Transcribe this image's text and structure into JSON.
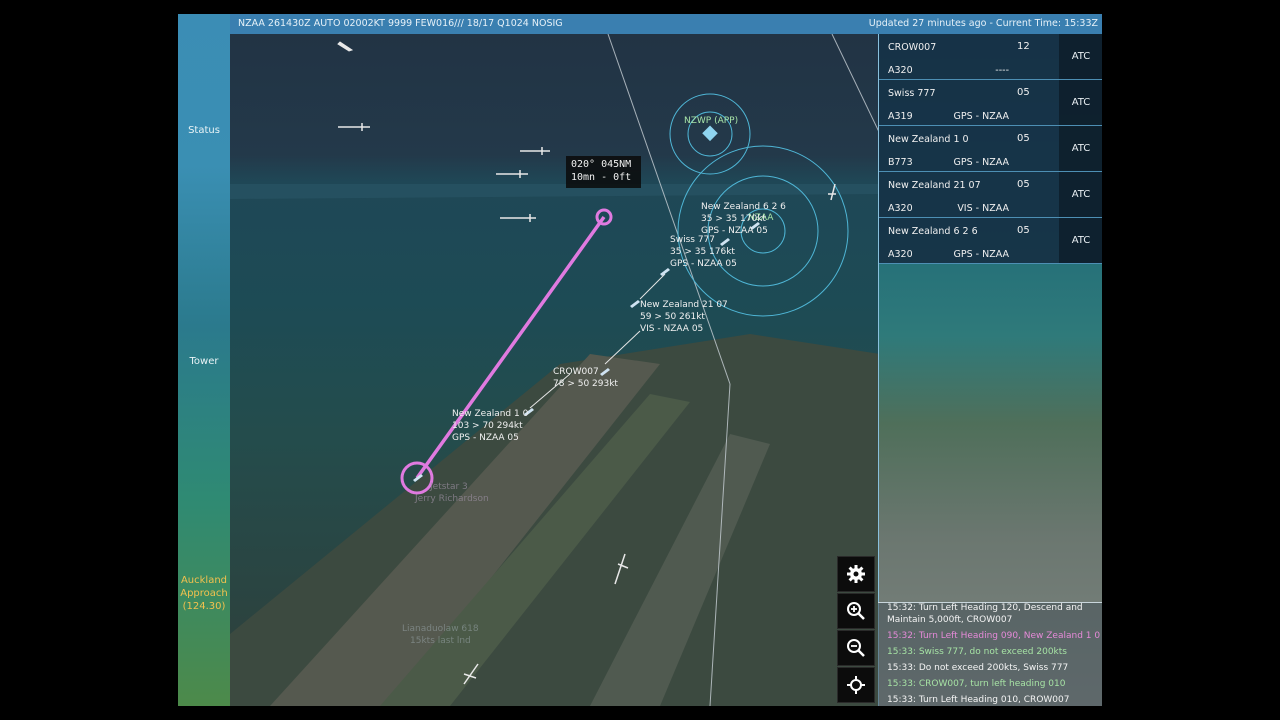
{
  "header": {
    "metar": "NZAA 261430Z AUTO 02002KT 9999 FEW016/// 18/17 Q1024 NOSIG",
    "updated": "Updated 27 minutes ago - Current Time: 15:33Z"
  },
  "sidebar": {
    "status": "Status",
    "tower": "Tower",
    "approach_line1": "Auckland",
    "approach_line2": "Approach",
    "approach_freq": "(124.30)"
  },
  "map": {
    "heading_box_line1": "020° 045NM",
    "heading_box_line2": "10mn - 0ft",
    "waypoint_nzwp": "NZWP (APP)",
    "airport_nzaa": "NZAA",
    "aircraft": [
      {
        "name": "New Zealand 6 2 6",
        "line2": "35 > 35 170kt",
        "line3": "GPS - NZAA 05"
      },
      {
        "name": "Swiss 777",
        "line2": "35 > 35 176kt",
        "line3": "GPS - NZAA 05"
      },
      {
        "name": "New Zealand 21 07",
        "line2": "59 > 50 261kt",
        "line3": "VIS - NZAA 05"
      },
      {
        "name": "CROW007",
        "line2": "78 > 50 293kt",
        "line3": ""
      },
      {
        "name": "New Zealand 1 0",
        "line2": "103 > 70 294kt",
        "line3": "GPS - NZAA 05"
      }
    ],
    "ground_label_1": "Jetstar 3",
    "ground_label_2": "Jerry Richardson",
    "ground_label_3": "Lianaduolaw 618",
    "ground_label_4": "15kts last lnd"
  },
  "flight_strips": [
    {
      "callsign": "CROW007",
      "alt": "12",
      "type": "A320",
      "route": "----",
      "action": "ATC"
    },
    {
      "callsign": "Swiss 777",
      "alt": "05",
      "type": "A319",
      "route": "GPS - NZAA",
      "action": "ATC"
    },
    {
      "callsign": "New Zealand 1 0",
      "alt": "05",
      "type": "B773",
      "route": "GPS - NZAA",
      "action": "ATC"
    },
    {
      "callsign": "New Zealand 21 07",
      "alt": "05",
      "type": "A320",
      "route": "VIS - NZAA",
      "action": "ATC"
    },
    {
      "callsign": "New Zealand 6 2 6",
      "alt": "05",
      "type": "A320",
      "route": "GPS - NZAA",
      "action": "ATC"
    }
  ],
  "log": [
    {
      "text": "15:32: Turn Left Heading 120, Descend and",
      "color": "white"
    },
    {
      "text": "Maintain 5,000ft, CROW007",
      "color": "white"
    },
    {
      "text": "15:32: Turn Left Heading 090, New Zealand 1 0",
      "color": "pink"
    },
    {
      "text": "15:33: Swiss 777, do not exceed 200kts",
      "color": "green"
    },
    {
      "text": "15:33: Do not exceed 200kts, Swiss 777",
      "color": "white"
    },
    {
      "text": "15:33: CROW007, turn left heading 010",
      "color": "green"
    },
    {
      "text": "15:33: Turn Left Heading 010, CROW007",
      "color": "white"
    }
  ],
  "controls": [
    "gear-icon",
    "zoom-in-icon",
    "zoom-out-icon",
    "recenter-icon"
  ],
  "colors": {
    "accent": "#3a7fb0",
    "route": "#e07ae0",
    "approach_text": "#f2c14e",
    "range_ring": "#4fb6d6"
  }
}
